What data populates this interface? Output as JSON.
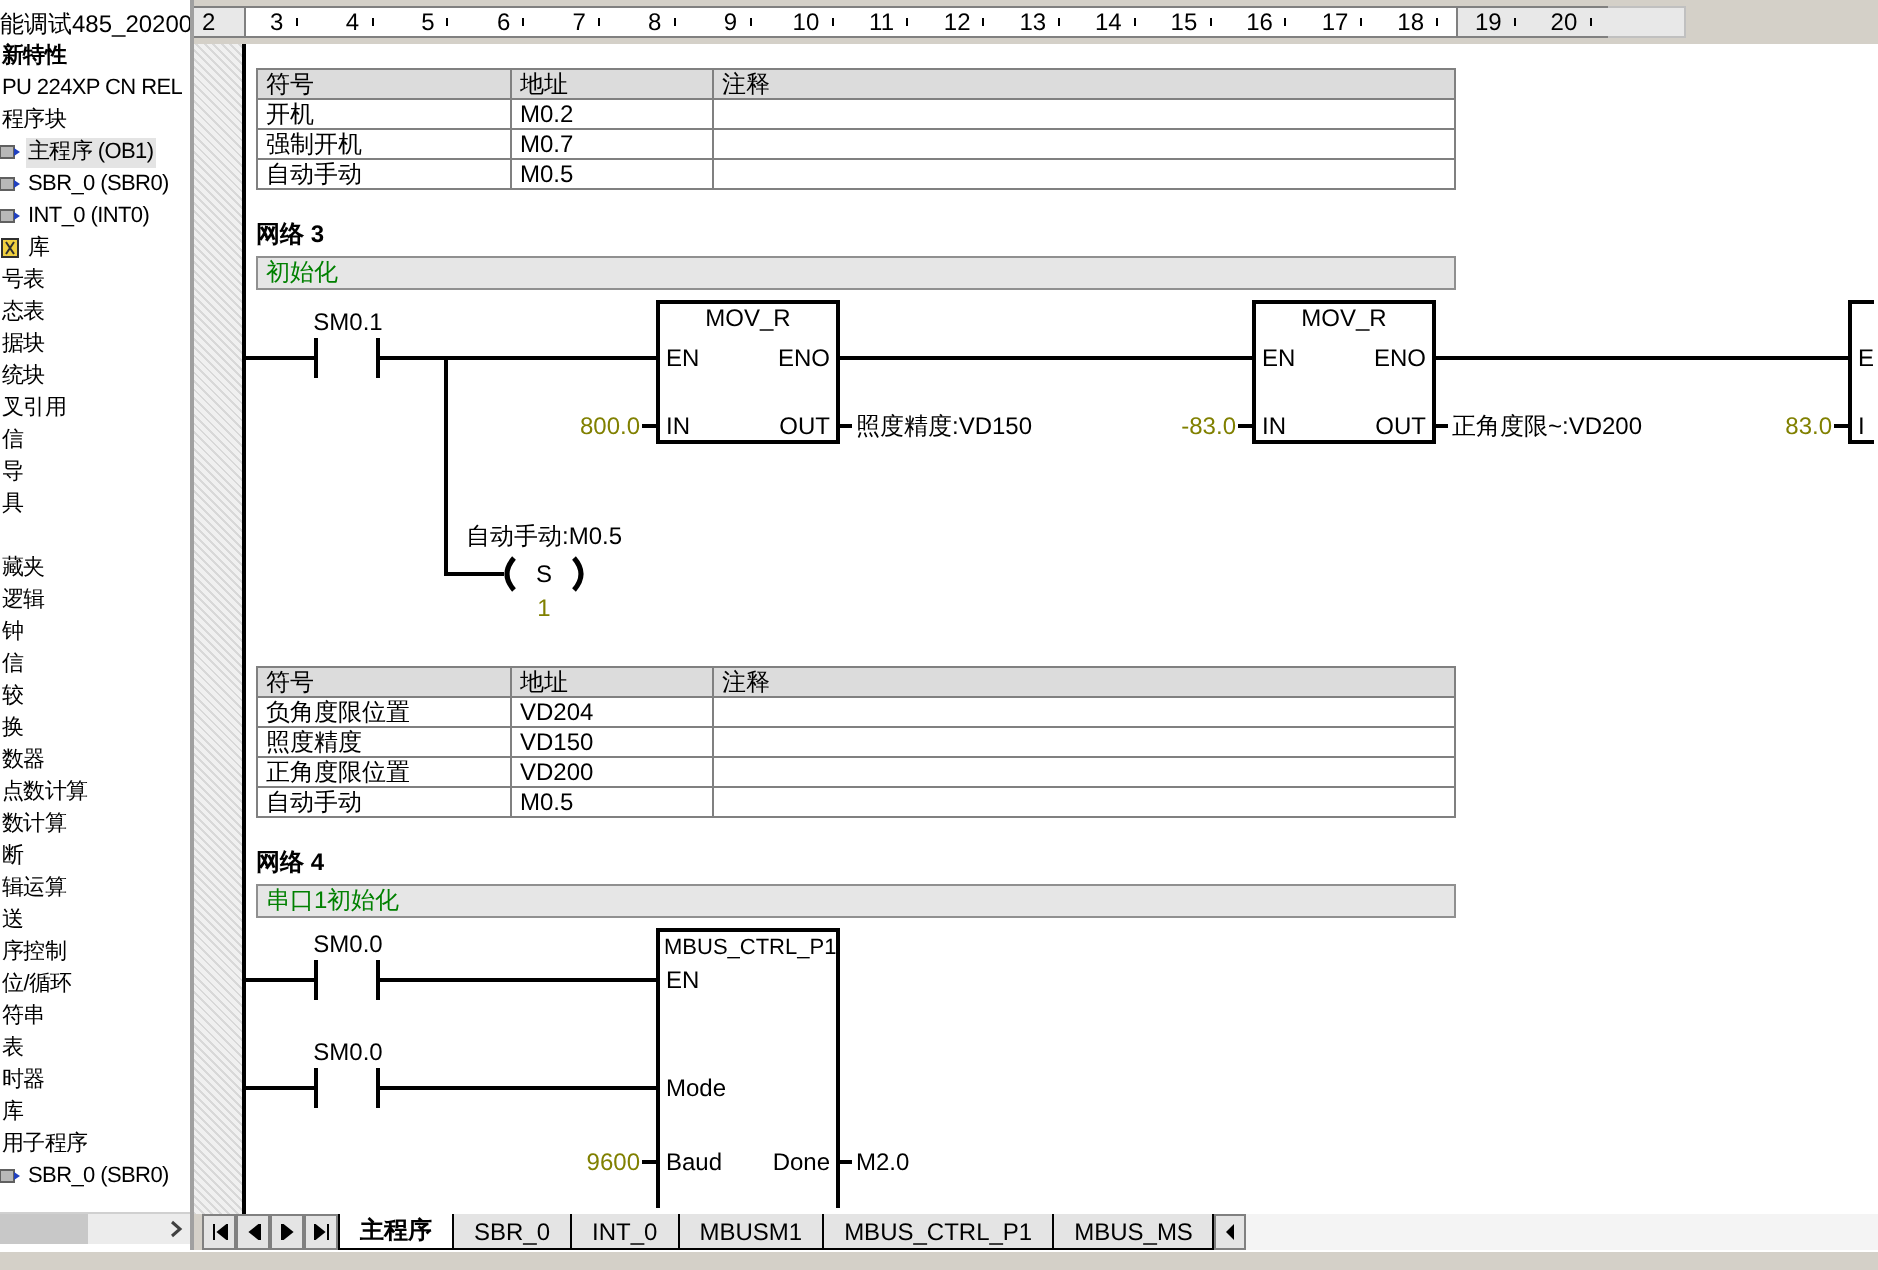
{
  "sidebar": {
    "header": "能调试485_20200",
    "groups": [
      {
        "items": [
          {
            "label": "新特性",
            "bold": true,
            "selected": false
          },
          {
            "label": "PU 224XP CN REL",
            "selected": false
          },
          {
            "label": "程序块",
            "selected": false,
            "children": [
              {
                "label": "主程序 (OB1)",
                "kind": "block",
                "selected": true
              },
              {
                "label": "SBR_0 (SBR0)",
                "kind": "block",
                "selected": false
              },
              {
                "label": "INT_0 (INT0)",
                "kind": "block",
                "selected": false
              }
            ]
          },
          {
            "label": "库",
            "kind": "library",
            "selected": false
          },
          {
            "label": "号表",
            "selected": false
          },
          {
            "label": "态表",
            "selected": false
          },
          {
            "label": "据块",
            "selected": false
          },
          {
            "label": "统块",
            "selected": false
          },
          {
            "label": "叉引用",
            "selected": false
          },
          {
            "label": "信",
            "selected": false
          },
          {
            "label": "导",
            "selected": false
          },
          {
            "label": "具",
            "selected": false
          }
        ]
      },
      {
        "items": [
          {
            "label": "藏夹",
            "selected": false
          },
          {
            "label": "逻辑",
            "selected": false
          },
          {
            "label": "钟",
            "selected": false
          },
          {
            "label": "信",
            "selected": false
          },
          {
            "label": "较",
            "selected": false
          },
          {
            "label": "换",
            "selected": false
          },
          {
            "label": "数器",
            "selected": false
          },
          {
            "label": "点数计算",
            "selected": false
          },
          {
            "label": "数计算",
            "selected": false
          },
          {
            "label": "断",
            "selected": false
          },
          {
            "label": "辑运算",
            "selected": false
          },
          {
            "label": "送",
            "selected": false
          },
          {
            "label": "序控制",
            "selected": false
          },
          {
            "label": "位/循环",
            "selected": false
          },
          {
            "label": "符串",
            "selected": false
          },
          {
            "label": "表",
            "selected": false
          },
          {
            "label": "时器",
            "selected": false
          },
          {
            "label": "库",
            "selected": false
          },
          {
            "label": "用子程序",
            "selected": false,
            "children": [
              {
                "label": "SBR_0 (SBR0)",
                "kind": "block",
                "selected": false
              }
            ]
          }
        ]
      }
    ]
  },
  "ruler": {
    "numbers": [
      {
        "label": "2",
        "active": false
      },
      {
        "label": "3",
        "active": true
      },
      {
        "label": "4",
        "active": true
      },
      {
        "label": "5",
        "active": true
      },
      {
        "label": "6",
        "active": true
      },
      {
        "label": "7",
        "active": true
      },
      {
        "label": "8",
        "active": true
      },
      {
        "label": "9",
        "active": true
      },
      {
        "label": "10",
        "active": true
      },
      {
        "label": "11",
        "active": true
      },
      {
        "label": "12",
        "active": true
      },
      {
        "label": "13",
        "active": true
      },
      {
        "label": "14",
        "active": true
      },
      {
        "label": "15",
        "active": true
      },
      {
        "label": "16",
        "active": true
      },
      {
        "label": "17",
        "active": true
      },
      {
        "label": "18",
        "active": true
      },
      {
        "label": "19",
        "active": false
      },
      {
        "label": "20",
        "active": false
      }
    ]
  },
  "blocks": [
    {
      "kind": "symbol_table",
      "columns": [
        "符号",
        "地址",
        "注释"
      ],
      "rows": [
        [
          "开机",
          "M0.2"
        ],
        [
          "强制开机",
          "M0.7"
        ],
        [
          "自动手动",
          "M0.5"
        ]
      ]
    },
    {
      "kind": "network",
      "title": "网络 3",
      "comment": "初始化",
      "ladder": {
        "kind": "mov_chain",
        "contact": "SM0.1",
        "boxes": [
          {
            "title": "MOV_R",
            "en": "EN",
            "eno": "ENO",
            "in_pin": "IN",
            "out_pin": "OUT",
            "in_value": "800.0",
            "out_value": "照度精度:VD150"
          },
          {
            "title": "MOV_R",
            "en": "EN",
            "eno": "ENO",
            "in_pin": "IN",
            "out_pin": "OUT",
            "in_value": "-83.0",
            "out_value": "正角度限~:VD200"
          },
          {
            "en": "E",
            "in_pin": "I",
            "in_value": "83.0"
          }
        ],
        "coil": {
          "label": "自动手动:M0.5",
          "type": "S",
          "value": "1"
        }
      }
    },
    {
      "kind": "symbol_table",
      "columns": [
        "符号",
        "地址",
        "注释"
      ],
      "rows": [
        [
          "负角度限位置",
          "VD204"
        ],
        [
          "照度精度",
          "VD150"
        ],
        [
          "正角度限位置",
          "VD200"
        ],
        [
          "自动手动",
          "M0.5"
        ]
      ]
    },
    {
      "kind": "network",
      "title": "网络 4",
      "comment": "串口1初始化",
      "ladder": {
        "kind": "mbus_ctrl",
        "contacts": [
          "SM0.0",
          "SM0.0"
        ],
        "box": {
          "title": "MBUS_CTRL_P1",
          "pins": [
            {
              "in": "EN"
            },
            {
              "in": "Mode"
            },
            {
              "in": "Baud",
              "in_value": "9600",
              "out": "Done",
              "out_value": "M2.0"
            }
          ]
        }
      }
    }
  ],
  "tabs": [
    {
      "label": "主程序",
      "selected": true
    },
    {
      "label": "SBR_0",
      "selected": false
    },
    {
      "label": "INT_0",
      "selected": false
    },
    {
      "label": "MBUSM1",
      "selected": false
    },
    {
      "label": "MBUS_CTRL_P1",
      "selected": false
    },
    {
      "label": "MBUS_MS",
      "selected": false
    }
  ]
}
